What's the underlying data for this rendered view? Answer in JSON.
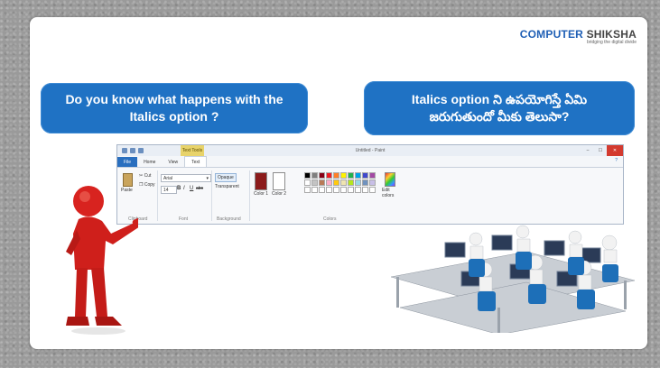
{
  "logo": {
    "brand_part1": "COMPUTER",
    "brand_part2": " SHIKSHA",
    "tagline": "bridging the digital divide"
  },
  "question_english": {
    "line1": "Do you know what happens with the",
    "line2": "Italics option ?"
  },
  "question_telugu": {
    "line1": "Italics option ని ఉపయోగిస్తే ఏమి",
    "line2": "జరుగుతుందో మీకు తెలుసా?"
  },
  "paint": {
    "context_tab": "Text Tools",
    "window_title": "Untitled - Paint",
    "window_controls": {
      "minimize": "‒",
      "maximize": "☐",
      "close": "✕"
    },
    "tabs": [
      "File",
      "Home",
      "View",
      "Text"
    ],
    "active_tab": "Text",
    "help_icon": "?",
    "clipboard": {
      "paste": "Paste",
      "cut": "Cut",
      "copy": "Copy",
      "label": "Clipboard"
    },
    "font": {
      "family": "Arial",
      "size": "14",
      "bold": "B",
      "italic": "I",
      "underline": "U",
      "strike": "abc",
      "label": "Font"
    },
    "background": {
      "opaque": "Opaque",
      "transparent": "Transparent",
      "label": "Background"
    },
    "colors": {
      "color1": "Color 1",
      "color2": "Color 2",
      "edit": "Edit colors",
      "label": "Colors",
      "color1_value": "#8b1a1a",
      "color2_value": "#ffffff"
    },
    "palette": [
      "#000000",
      "#7f7f7f",
      "#880015",
      "#ed1c24",
      "#ff7f27",
      "#fff200",
      "#22b14c",
      "#00a2e8",
      "#3f48cc",
      "#a349a4",
      "#ffffff",
      "#c3c3c3",
      "#b97a57",
      "#ffaec9",
      "#ffc90e",
      "#efe4b0",
      "#b5e61d",
      "#99d9ea",
      "#7092be",
      "#c8bfe7",
      "#ffffff",
      "#ffffff",
      "#ffffff",
      "#ffffff",
      "#ffffff",
      "#ffffff",
      "#ffffff",
      "#ffffff",
      "#ffffff",
      "#ffffff"
    ]
  },
  "colors": {
    "bubble_blue": "#1f72c4",
    "card_bg": "#ffffff",
    "page_bg": "#9a9a9a"
  }
}
